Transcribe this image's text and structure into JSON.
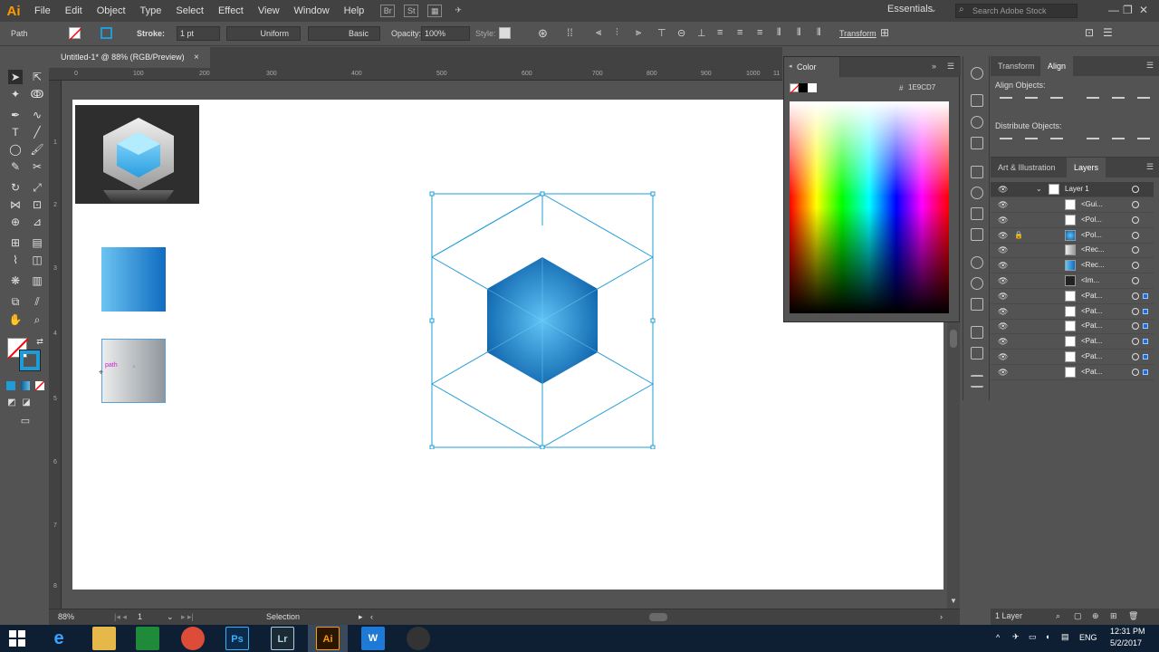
{
  "menubar": {
    "logo": "Ai",
    "items": [
      "File",
      "Edit",
      "Object",
      "Type",
      "Select",
      "Effect",
      "View",
      "Window",
      "Help"
    ],
    "workspace": "Essentials",
    "search_placeholder": "Search Adobe Stock"
  },
  "controlbar": {
    "selection_type": "Path",
    "stroke_label": "Stroke:",
    "stroke_weight": "1 pt",
    "profile": "Uniform",
    "brush": "Basic",
    "opacity_label": "Opacity:",
    "opacity": "100%",
    "style_label": "Style:",
    "transform_label": "Transform"
  },
  "document": {
    "tab_title": "Untitled-1* @ 88% (RGB/Preview)",
    "close_glyph": "×"
  },
  "rulers": {
    "top": [
      "0",
      "100",
      "200",
      "300",
      "400",
      "500",
      "600",
      "700",
      "800",
      "900",
      "1000",
      "11"
    ],
    "left": [
      "1",
      "2",
      "3",
      "4",
      "5",
      "6",
      "7",
      "8"
    ]
  },
  "canvas": {
    "tooltip": "path",
    "selection_color": "#1E9CD7"
  },
  "status": {
    "zoom": "88%",
    "artboard_num": "1",
    "tool_name": "Selection"
  },
  "color_panel": {
    "tab": "Color",
    "hex_prefix": "#",
    "hex": "1E9CD7"
  },
  "align_panel": {
    "tabs": [
      "Transform",
      "Align"
    ],
    "align_objects_title": "Align Objects:",
    "distribute_objects_title": "Distribute Objects:"
  },
  "layers_panel": {
    "tabs": [
      "Art & Illustration",
      "Layers"
    ],
    "layer_name": "Layer 1",
    "items": [
      "<Gui...",
      "<Pol...",
      "<Pol...",
      "<Rec...",
      "<Rec...",
      "<Im...",
      "<Pat...",
      "<Pat...",
      "<Pat...",
      "<Pat...",
      "<Pat...",
      "<Pat..."
    ],
    "footer_count": "1 Layer"
  },
  "taskbar": {
    "apps": [
      "e",
      "",
      "",
      "",
      "Ps",
      "Lr",
      "Ai",
      "W",
      ""
    ],
    "lang": "ENG",
    "time": "12:31 PM",
    "date": "5/2/2017"
  }
}
